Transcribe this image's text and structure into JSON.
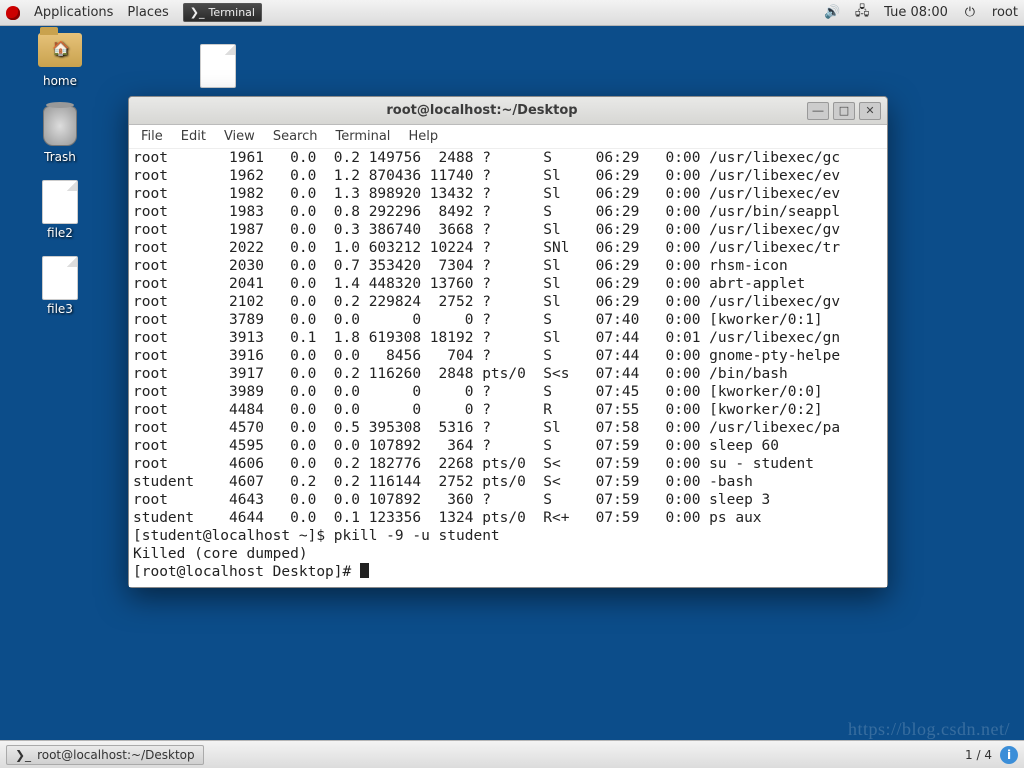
{
  "topbar": {
    "applications": "Applications",
    "places": "Places",
    "task_label": "Terminal",
    "clock": "Tue 08:00",
    "user": "root"
  },
  "desktop_icons": {
    "home": "home",
    "trash": "Trash",
    "file2": "file2",
    "file3": "file3"
  },
  "window": {
    "title": "root@localhost:~/Desktop",
    "menu": {
      "file": "File",
      "edit": "Edit",
      "view": "View",
      "search": "Search",
      "terminal": "Terminal",
      "help": "Help"
    }
  },
  "ps_rows": [
    {
      "user": "root",
      "pid": "1961",
      "cpu": "0.0",
      "mem": "0.2",
      "vsz": "149756",
      "rss": "2488",
      "tty": "?",
      "stat": "S",
      "start": "06:29",
      "time": "0:00",
      "cmd": "/usr/libexec/gc"
    },
    {
      "user": "root",
      "pid": "1962",
      "cpu": "0.0",
      "mem": "1.2",
      "vsz": "870436",
      "rss": "11740",
      "tty": "?",
      "stat": "Sl",
      "start": "06:29",
      "time": "0:00",
      "cmd": "/usr/libexec/ev"
    },
    {
      "user": "root",
      "pid": "1982",
      "cpu": "0.0",
      "mem": "1.3",
      "vsz": "898920",
      "rss": "13432",
      "tty": "?",
      "stat": "Sl",
      "start": "06:29",
      "time": "0:00",
      "cmd": "/usr/libexec/ev"
    },
    {
      "user": "root",
      "pid": "1983",
      "cpu": "0.0",
      "mem": "0.8",
      "vsz": "292296",
      "rss": "8492",
      "tty": "?",
      "stat": "S",
      "start": "06:29",
      "time": "0:00",
      "cmd": "/usr/bin/seappl"
    },
    {
      "user": "root",
      "pid": "1987",
      "cpu": "0.0",
      "mem": "0.3",
      "vsz": "386740",
      "rss": "3668",
      "tty": "?",
      "stat": "Sl",
      "start": "06:29",
      "time": "0:00",
      "cmd": "/usr/libexec/gv"
    },
    {
      "user": "root",
      "pid": "2022",
      "cpu": "0.0",
      "mem": "1.0",
      "vsz": "603212",
      "rss": "10224",
      "tty": "?",
      "stat": "SNl",
      "start": "06:29",
      "time": "0:00",
      "cmd": "/usr/libexec/tr"
    },
    {
      "user": "root",
      "pid": "2030",
      "cpu": "0.0",
      "mem": "0.7",
      "vsz": "353420",
      "rss": "7304",
      "tty": "?",
      "stat": "Sl",
      "start": "06:29",
      "time": "0:00",
      "cmd": "rhsm-icon"
    },
    {
      "user": "root",
      "pid": "2041",
      "cpu": "0.0",
      "mem": "1.4",
      "vsz": "448320",
      "rss": "13760",
      "tty": "?",
      "stat": "Sl",
      "start": "06:29",
      "time": "0:00",
      "cmd": "abrt-applet"
    },
    {
      "user": "root",
      "pid": "2102",
      "cpu": "0.0",
      "mem": "0.2",
      "vsz": "229824",
      "rss": "2752",
      "tty": "?",
      "stat": "Sl",
      "start": "06:29",
      "time": "0:00",
      "cmd": "/usr/libexec/gv"
    },
    {
      "user": "root",
      "pid": "3789",
      "cpu": "0.0",
      "mem": "0.0",
      "vsz": "0",
      "rss": "0",
      "tty": "?",
      "stat": "S",
      "start": "07:40",
      "time": "0:00",
      "cmd": "[kworker/0:1]"
    },
    {
      "user": "root",
      "pid": "3913",
      "cpu": "0.1",
      "mem": "1.8",
      "vsz": "619308",
      "rss": "18192",
      "tty": "?",
      "stat": "Sl",
      "start": "07:44",
      "time": "0:01",
      "cmd": "/usr/libexec/gn"
    },
    {
      "user": "root",
      "pid": "3916",
      "cpu": "0.0",
      "mem": "0.0",
      "vsz": "8456",
      "rss": "704",
      "tty": "?",
      "stat": "S",
      "start": "07:44",
      "time": "0:00",
      "cmd": "gnome-pty-helpe"
    },
    {
      "user": "root",
      "pid": "3917",
      "cpu": "0.0",
      "mem": "0.2",
      "vsz": "116260",
      "rss": "2848",
      "tty": "pts/0",
      "stat": "S<s",
      "start": "07:44",
      "time": "0:00",
      "cmd": "/bin/bash"
    },
    {
      "user": "root",
      "pid": "3989",
      "cpu": "0.0",
      "mem": "0.0",
      "vsz": "0",
      "rss": "0",
      "tty": "?",
      "stat": "S",
      "start": "07:45",
      "time": "0:00",
      "cmd": "[kworker/0:0]"
    },
    {
      "user": "root",
      "pid": "4484",
      "cpu": "0.0",
      "mem": "0.0",
      "vsz": "0",
      "rss": "0",
      "tty": "?",
      "stat": "R",
      "start": "07:55",
      "time": "0:00",
      "cmd": "[kworker/0:2]"
    },
    {
      "user": "root",
      "pid": "4570",
      "cpu": "0.0",
      "mem": "0.5",
      "vsz": "395308",
      "rss": "5316",
      "tty": "?",
      "stat": "Sl",
      "start": "07:58",
      "time": "0:00",
      "cmd": "/usr/libexec/pa"
    },
    {
      "user": "root",
      "pid": "4595",
      "cpu": "0.0",
      "mem": "0.0",
      "vsz": "107892",
      "rss": "364",
      "tty": "?",
      "stat": "S",
      "start": "07:59",
      "time": "0:00",
      "cmd": "sleep 60"
    },
    {
      "user": "root",
      "pid": "4606",
      "cpu": "0.0",
      "mem": "0.2",
      "vsz": "182776",
      "rss": "2268",
      "tty": "pts/0",
      "stat": "S<",
      "start": "07:59",
      "time": "0:00",
      "cmd": "su - student"
    },
    {
      "user": "student",
      "pid": "4607",
      "cpu": "0.2",
      "mem": "0.2",
      "vsz": "116144",
      "rss": "2752",
      "tty": "pts/0",
      "stat": "S<",
      "start": "07:59",
      "time": "0:00",
      "cmd": "-bash"
    },
    {
      "user": "root",
      "pid": "4643",
      "cpu": "0.0",
      "mem": "0.0",
      "vsz": "107892",
      "rss": "360",
      "tty": "?",
      "stat": "S",
      "start": "07:59",
      "time": "0:00",
      "cmd": "sleep 3"
    },
    {
      "user": "student",
      "pid": "4644",
      "cpu": "0.0",
      "mem": "0.1",
      "vsz": "123356",
      "rss": "1324",
      "tty": "pts/0",
      "stat": "R<+",
      "start": "07:59",
      "time": "0:00",
      "cmd": "ps aux"
    }
  ],
  "term_tail": {
    "line1": "[student@localhost ~]$ pkill -9 -u student",
    "line2": "Killed (core dumped)",
    "line3": "[root@localhost Desktop]# "
  },
  "bottombar": {
    "task": "root@localhost:~/Desktop",
    "pager": "1 / 4"
  },
  "watermark": "https://blog.csdn.net/"
}
